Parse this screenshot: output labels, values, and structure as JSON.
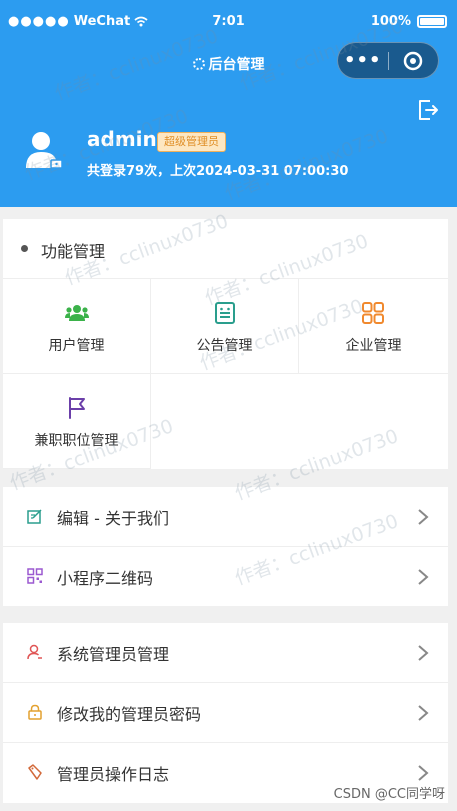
{
  "status_bar": {
    "carrier": "WeChat",
    "time": "7:01",
    "battery": "100%"
  },
  "nav": {
    "title": "后台管理",
    "capsule_more": "•••"
  },
  "profile": {
    "username": "admin",
    "role": "超级管理员",
    "login_info": "共登录79次，上次2024-03-31 07:00:30"
  },
  "functions": {
    "title": "功能管理",
    "items": [
      {
        "label": "用户管理",
        "icon": "users-icon"
      },
      {
        "label": "公告管理",
        "icon": "notice-icon"
      },
      {
        "label": "企业管理",
        "icon": "grid-icon"
      },
      {
        "label": "兼职职位管理",
        "icon": "flag-icon"
      }
    ]
  },
  "list1": [
    {
      "label": "编辑 - 关于我们",
      "icon": "edit-icon"
    },
    {
      "label": "小程序二维码",
      "icon": "qrcode-icon"
    }
  ],
  "list2": [
    {
      "label": "系统管理员管理",
      "icon": "user-icon"
    },
    {
      "label": "修改我的管理员密码",
      "icon": "lock-icon"
    },
    {
      "label": "管理员操作日志",
      "icon": "log-icon"
    }
  ],
  "watermark": "作者：cclinux0730",
  "footer": {
    "credit": "CSDN @CC同学呀"
  },
  "colors": {
    "header": "#2c9cf0",
    "users": "#3bb24a",
    "notice": "#2a9e8d",
    "grid": "#f0892e",
    "flag": "#6b3fa9"
  }
}
